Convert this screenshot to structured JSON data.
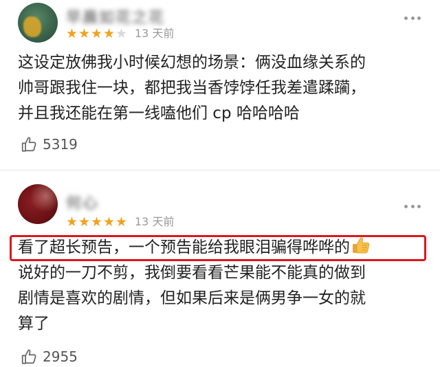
{
  "comments": [
    {
      "username": "早晨如花之花",
      "rating": 4,
      "rating_max": 5,
      "date": "13 天前",
      "lines": [
        "这设定放佛我小时候幻想的场景：俩没血缘关系的",
        "帅哥跟我住一块，都把我当香饽饽任我差遣蹂躏，",
        "并且我还能在第一线嗑他们 cp 哈哈哈哈"
      ],
      "likes": "5319",
      "more_icon": "more-dots-icon",
      "like_icon": "thumbs-up-outline-icon"
    },
    {
      "username": "何心",
      "rating": 5,
      "rating_max": 5,
      "date": "13 天前",
      "highlight_line": "看了超长预告，一个预告能给我眼泪骗得哗哗的",
      "highlight_emoji": "thumbs-up-emoji",
      "lines": [
        "说好的一刀不剪，我倒要看看芒果能不能真的做到",
        "剧情是喜欢的剧情，但如果后来是俩男争一女的就",
        "算了"
      ],
      "likes": "2955",
      "more_icon": "more-dots-icon",
      "like_icon": "thumbs-up-outline-icon"
    }
  ],
  "colors": {
    "star": "#f1a21f",
    "star_empty": "#d8d8d8",
    "highlight_border": "#e0131c",
    "meta_text": "#999999",
    "body_text": "#222222"
  }
}
